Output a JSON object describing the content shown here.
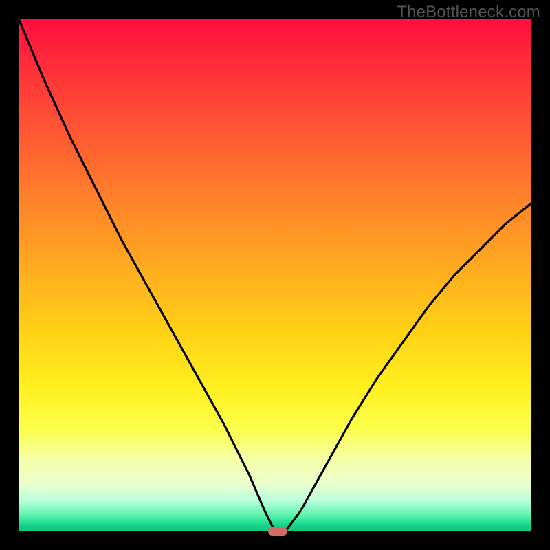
{
  "watermark": "TheBottleneck.com",
  "colors": {
    "curve": "#000000",
    "marker": "#d46a64",
    "frame_bg": "#000000"
  },
  "chart_data": {
    "type": "line",
    "title": "",
    "xlabel": "",
    "ylabel": "",
    "xlim": [
      0,
      100
    ],
    "ylim": [
      0,
      100
    ],
    "grid": false,
    "legend": false,
    "annotations": [],
    "series": [
      {
        "name": "bottleneck-curve",
        "x": [
          0,
          5,
          10,
          15,
          20,
          25,
          30,
          35,
          40,
          45,
          48,
          50,
          52,
          55,
          60,
          65,
          70,
          75,
          80,
          85,
          90,
          95,
          100
        ],
        "y": [
          100,
          88,
          77,
          67,
          57,
          48,
          39,
          30,
          21,
          11,
          4,
          0,
          0,
          4,
          13,
          22,
          30,
          37,
          44,
          50,
          55,
          60,
          64
        ]
      }
    ],
    "minimum_marker": {
      "x": 50.5,
      "y": 0
    },
    "background_gradient": {
      "orientation": "vertical",
      "stops": [
        {
          "pos": 0.0,
          "color": "#ff0d3e"
        },
        {
          "pos": 0.5,
          "color": "#ffb01e"
        },
        {
          "pos": 0.8,
          "color": "#fbff4a"
        },
        {
          "pos": 1.0,
          "color": "#0fc97e"
        }
      ]
    }
  }
}
